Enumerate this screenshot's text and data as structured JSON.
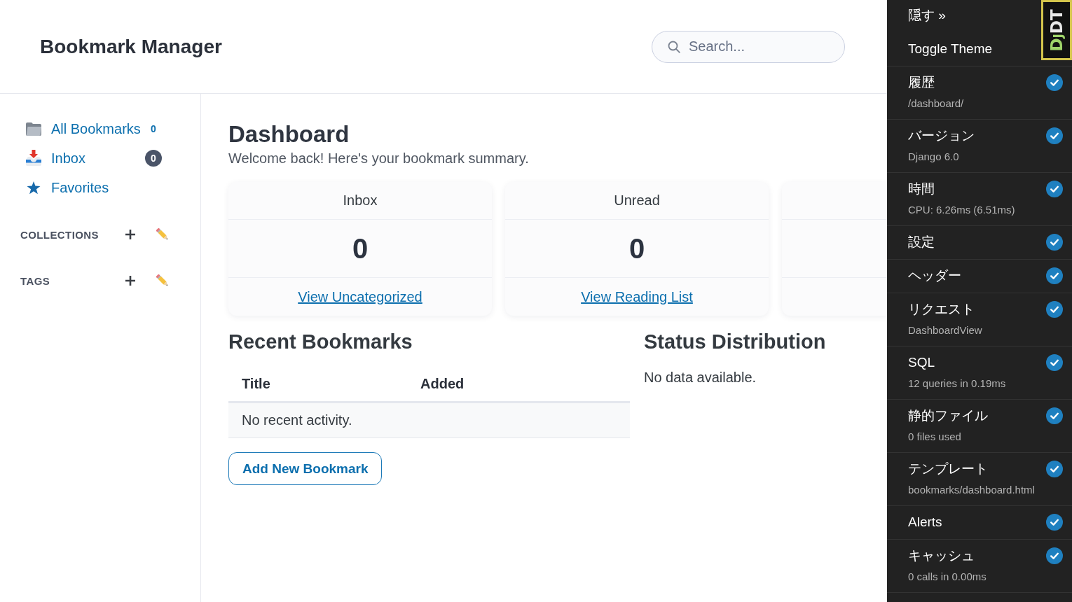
{
  "header": {
    "title": "Bookmark Manager",
    "search": {
      "placeholder": "Search..."
    }
  },
  "sidebar": {
    "items": [
      {
        "label": "All Bookmarks",
        "count": {
          "text": "0",
          "kind": "plain"
        }
      },
      {
        "label": "Inbox",
        "count": {
          "text": "0",
          "kind": "badge"
        }
      },
      {
        "label": "Favorites"
      }
    ],
    "sections": [
      {
        "label": "COLLECTIONS"
      },
      {
        "label": "TAGS"
      }
    ]
  },
  "dashboard": {
    "title": "Dashboard",
    "subtitle": "Welcome back! Here's your bookmark summary.",
    "cards": [
      {
        "label": "Inbox",
        "value": "0",
        "link": "View Uncategorized"
      },
      {
        "label": "Unread",
        "value": "0",
        "link": "View Reading List"
      }
    ]
  },
  "recent": {
    "title": "Recent Bookmarks",
    "columns": [
      "Title",
      "Added"
    ],
    "empty": "No recent activity.",
    "button": "Add New Bookmark"
  },
  "status": {
    "title": "Status Distribution",
    "empty": "No data available."
  },
  "debug_toolbar": {
    "hide": "隠す »",
    "toggle_theme": "Toggle Theme",
    "logo": [
      {
        "text": "D",
        "kind": "accent"
      },
      {
        "text": "J",
        "kind": "accent-small"
      },
      {
        "text": "DT",
        "kind": "plain"
      }
    ],
    "panels": [
      {
        "title": "履歴",
        "subtitle": "/dashboard/",
        "checked": true
      },
      {
        "title": "バージョン",
        "subtitle": "Django 6.0",
        "checked": true
      },
      {
        "title": "時間",
        "subtitle": "CPU: 6.26ms (6.51ms)",
        "checked": true
      },
      {
        "title": "設定",
        "checked": true
      },
      {
        "title": "ヘッダー",
        "checked": true
      },
      {
        "title": "リクエスト",
        "subtitle": "DashboardView",
        "checked": true
      },
      {
        "title": "SQL",
        "subtitle": "12 queries in 0.19ms",
        "checked": true
      },
      {
        "title": "静的ファイル",
        "subtitle": "0 files used",
        "checked": true
      },
      {
        "title": "テンプレート",
        "subtitle": "bookmarks/dashboard.html",
        "checked": true
      },
      {
        "title": "Alerts",
        "checked": true
      },
      {
        "title": "キャッシュ",
        "subtitle": "0 calls in 0.00ms",
        "checked": true
      }
    ]
  }
}
